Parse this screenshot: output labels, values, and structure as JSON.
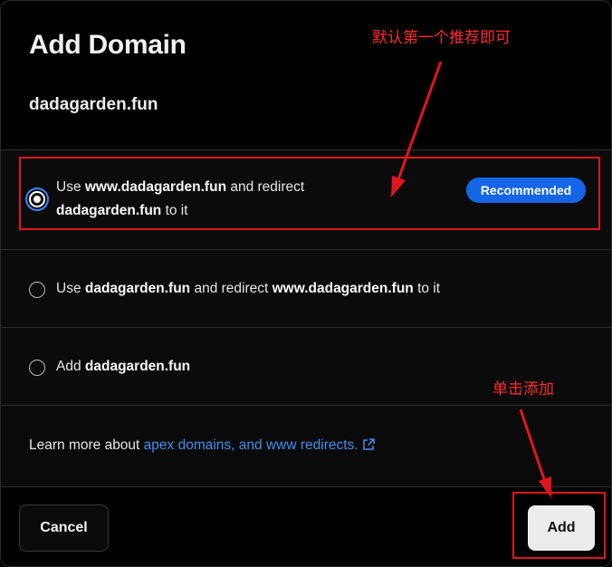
{
  "dialog": {
    "title": "Add Domain",
    "domain": "dadagarden.fun"
  },
  "options": [
    {
      "selected": true,
      "prefix": "Use ",
      "bold1": "www.dadagarden.fun",
      "mid": " and redirect",
      "bold2": "dadagarden.fun",
      "suffix": " to it",
      "badge": "Recommended"
    },
    {
      "selected": false,
      "prefix": "Use ",
      "bold1": "dadagarden.fun",
      "mid": " and redirect ",
      "bold2": "www.dadagarden.fun",
      "suffix": " to it"
    },
    {
      "selected": false,
      "prefix": "Add ",
      "bold1": "dadagarden.fun"
    }
  ],
  "learn_more": {
    "text": "Learn more about ",
    "link": "apex domains, and www redirects."
  },
  "footer": {
    "cancel": "Cancel",
    "add": "Add"
  },
  "annotations": {
    "note_default": "默认第一个推荐即可",
    "note_add": "单击添加",
    "color": "#e0161e"
  },
  "colors": {
    "accent": "#1466e6",
    "link": "#3f8ff0",
    "background": "#0a0a0a"
  }
}
